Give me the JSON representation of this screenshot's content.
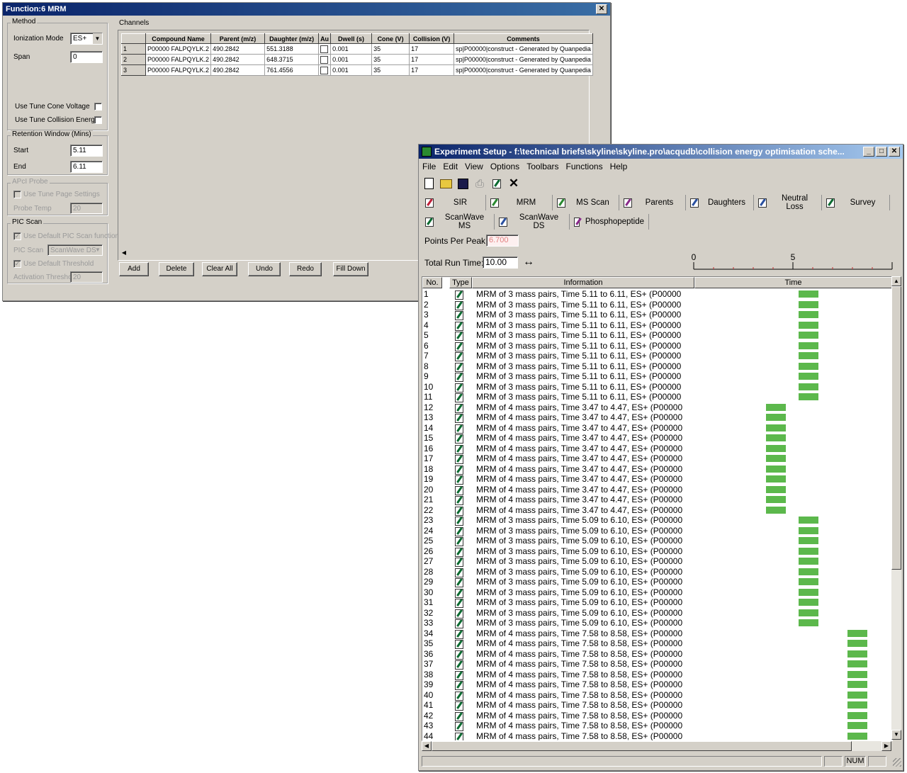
{
  "mrm_dialog": {
    "title": "Function:6 MRM",
    "close": "✕",
    "method": {
      "label": "Method",
      "ionization_mode_label": "Ionization Mode",
      "ionization_mode_value": "ES+",
      "span_label": "Span",
      "span_value": "0",
      "use_tune_cone_voltage": "Use Tune Cone Voltage",
      "use_tune_collision_energy": "Use Tune Collision Energy"
    },
    "retention_window": {
      "label": "Retention Window (Mins)",
      "start_label": "Start",
      "start_value": "5.11",
      "end_label": "End",
      "end_value": "6.11"
    },
    "apci_probe": {
      "label": "APcI Probe",
      "use_tune_page_settings": "Use Tune Page Settings",
      "probe_temp_label": "Probe Temp",
      "probe_temp_value": "20"
    },
    "pic_scan": {
      "label": "PIC Scan",
      "use_default_pic_scan_function": "Use Default PIC Scan function",
      "pic_scan_label": "PIC Scan",
      "pic_scan_value": "ScanWave DS",
      "use_default_threshold": "Use Default Threshold",
      "activation_threshold_label": "Activation Threshold",
      "activation_threshold_value": "20"
    },
    "channels": {
      "label": "Channels",
      "columns": [
        "Compound Name",
        "Parent (m/z)",
        "Daughter (m/z)",
        "Au",
        "Dwell (s)",
        "Cone (V)",
        "Collision (V)",
        "Comments"
      ],
      "rows": [
        {
          "n": "1",
          "compound": "P00000 FALPQYLK.2",
          "parent": "490.2842",
          "daughter": "551.3188",
          "dwell": "0.001",
          "cone": "35",
          "collision": "17",
          "comments": "sp|P00000|construct - Generated by Quanpedia"
        },
        {
          "n": "2",
          "compound": "P00000 FALPQYLK.2",
          "parent": "490.2842",
          "daughter": "648.3715",
          "dwell": "0.001",
          "cone": "35",
          "collision": "17",
          "comments": "sp|P00000|construct - Generated by Quanpedia"
        },
        {
          "n": "3",
          "compound": "P00000 FALPQYLK.2",
          "parent": "490.2842",
          "daughter": "761.4556",
          "dwell": "0.001",
          "cone": "35",
          "collision": "17",
          "comments": "sp|P00000|construct - Generated by Quanpedia"
        }
      ]
    },
    "buttons": {
      "add": "Add",
      "delete": "Delete",
      "clear_all": "Clear All",
      "undo": "Undo",
      "redo": "Redo",
      "fill_down": "Fill Down"
    }
  },
  "experiment_setup": {
    "title": "Experiment Setup - f:\\technical briefs\\skyline\\skyline.pro\\acqudb\\collision energy optimisation sche...",
    "window_buttons": {
      "minimize": "_",
      "maximize": "□",
      "close": "✕"
    },
    "menu": [
      "File",
      "Edit",
      "View",
      "Options",
      "Toolbars",
      "Functions",
      "Help"
    ],
    "functions_row1": [
      {
        "label": "SIR",
        "color": "red"
      },
      {
        "label": "MRM",
        "color": "green"
      },
      {
        "label": "MS Scan",
        "color": "green"
      },
      {
        "label": "Parents",
        "color": "purple"
      },
      {
        "label": "Daughters",
        "color": "blue"
      },
      {
        "label": "Neutral Loss",
        "color": "blue"
      },
      {
        "label": "Survey",
        "color": "dgreen"
      }
    ],
    "functions_row2": [
      {
        "label": "ScanWave MS",
        "color": "dgreen"
      },
      {
        "label": "ScanWave DS",
        "color": "blue"
      },
      {
        "label": "Phosphopeptide",
        "color": "purple"
      }
    ],
    "points_per_peak_label": "Points Per Peak:",
    "points_per_peak_value": "6.700",
    "total_run_time_label": "Total Run Time:",
    "total_run_time_value": "10.00",
    "time_axis": {
      "min": 0,
      "max": 10,
      "labels": [
        "0",
        "5"
      ]
    },
    "columns": {
      "no": "No.",
      "type": "Type",
      "information": "Information",
      "time": "Time"
    },
    "groups": [
      {
        "from": 1,
        "to": 11,
        "info": "MRM of 3 mass pairs, Time 5.11 to 6.11, ES+ (P00000",
        "start": 5.11,
        "end": 6.11
      },
      {
        "from": 12,
        "to": 22,
        "info": "MRM of 4 mass pairs, Time 3.47 to 4.47, ES+ (P00000",
        "start": 3.47,
        "end": 4.47
      },
      {
        "from": 23,
        "to": 33,
        "info": "MRM of 3 mass pairs, Time 5.09 to 6.10, ES+ (P00000",
        "start": 5.09,
        "end": 6.1
      },
      {
        "from": 34,
        "to": 44,
        "info": "MRM of 4 mass pairs, Time 7.58 to 8.58, ES+ (P00000",
        "start": 7.58,
        "end": 8.58
      }
    ],
    "status": {
      "num": "NUM"
    },
    "bar_color": "#5cb84c"
  }
}
